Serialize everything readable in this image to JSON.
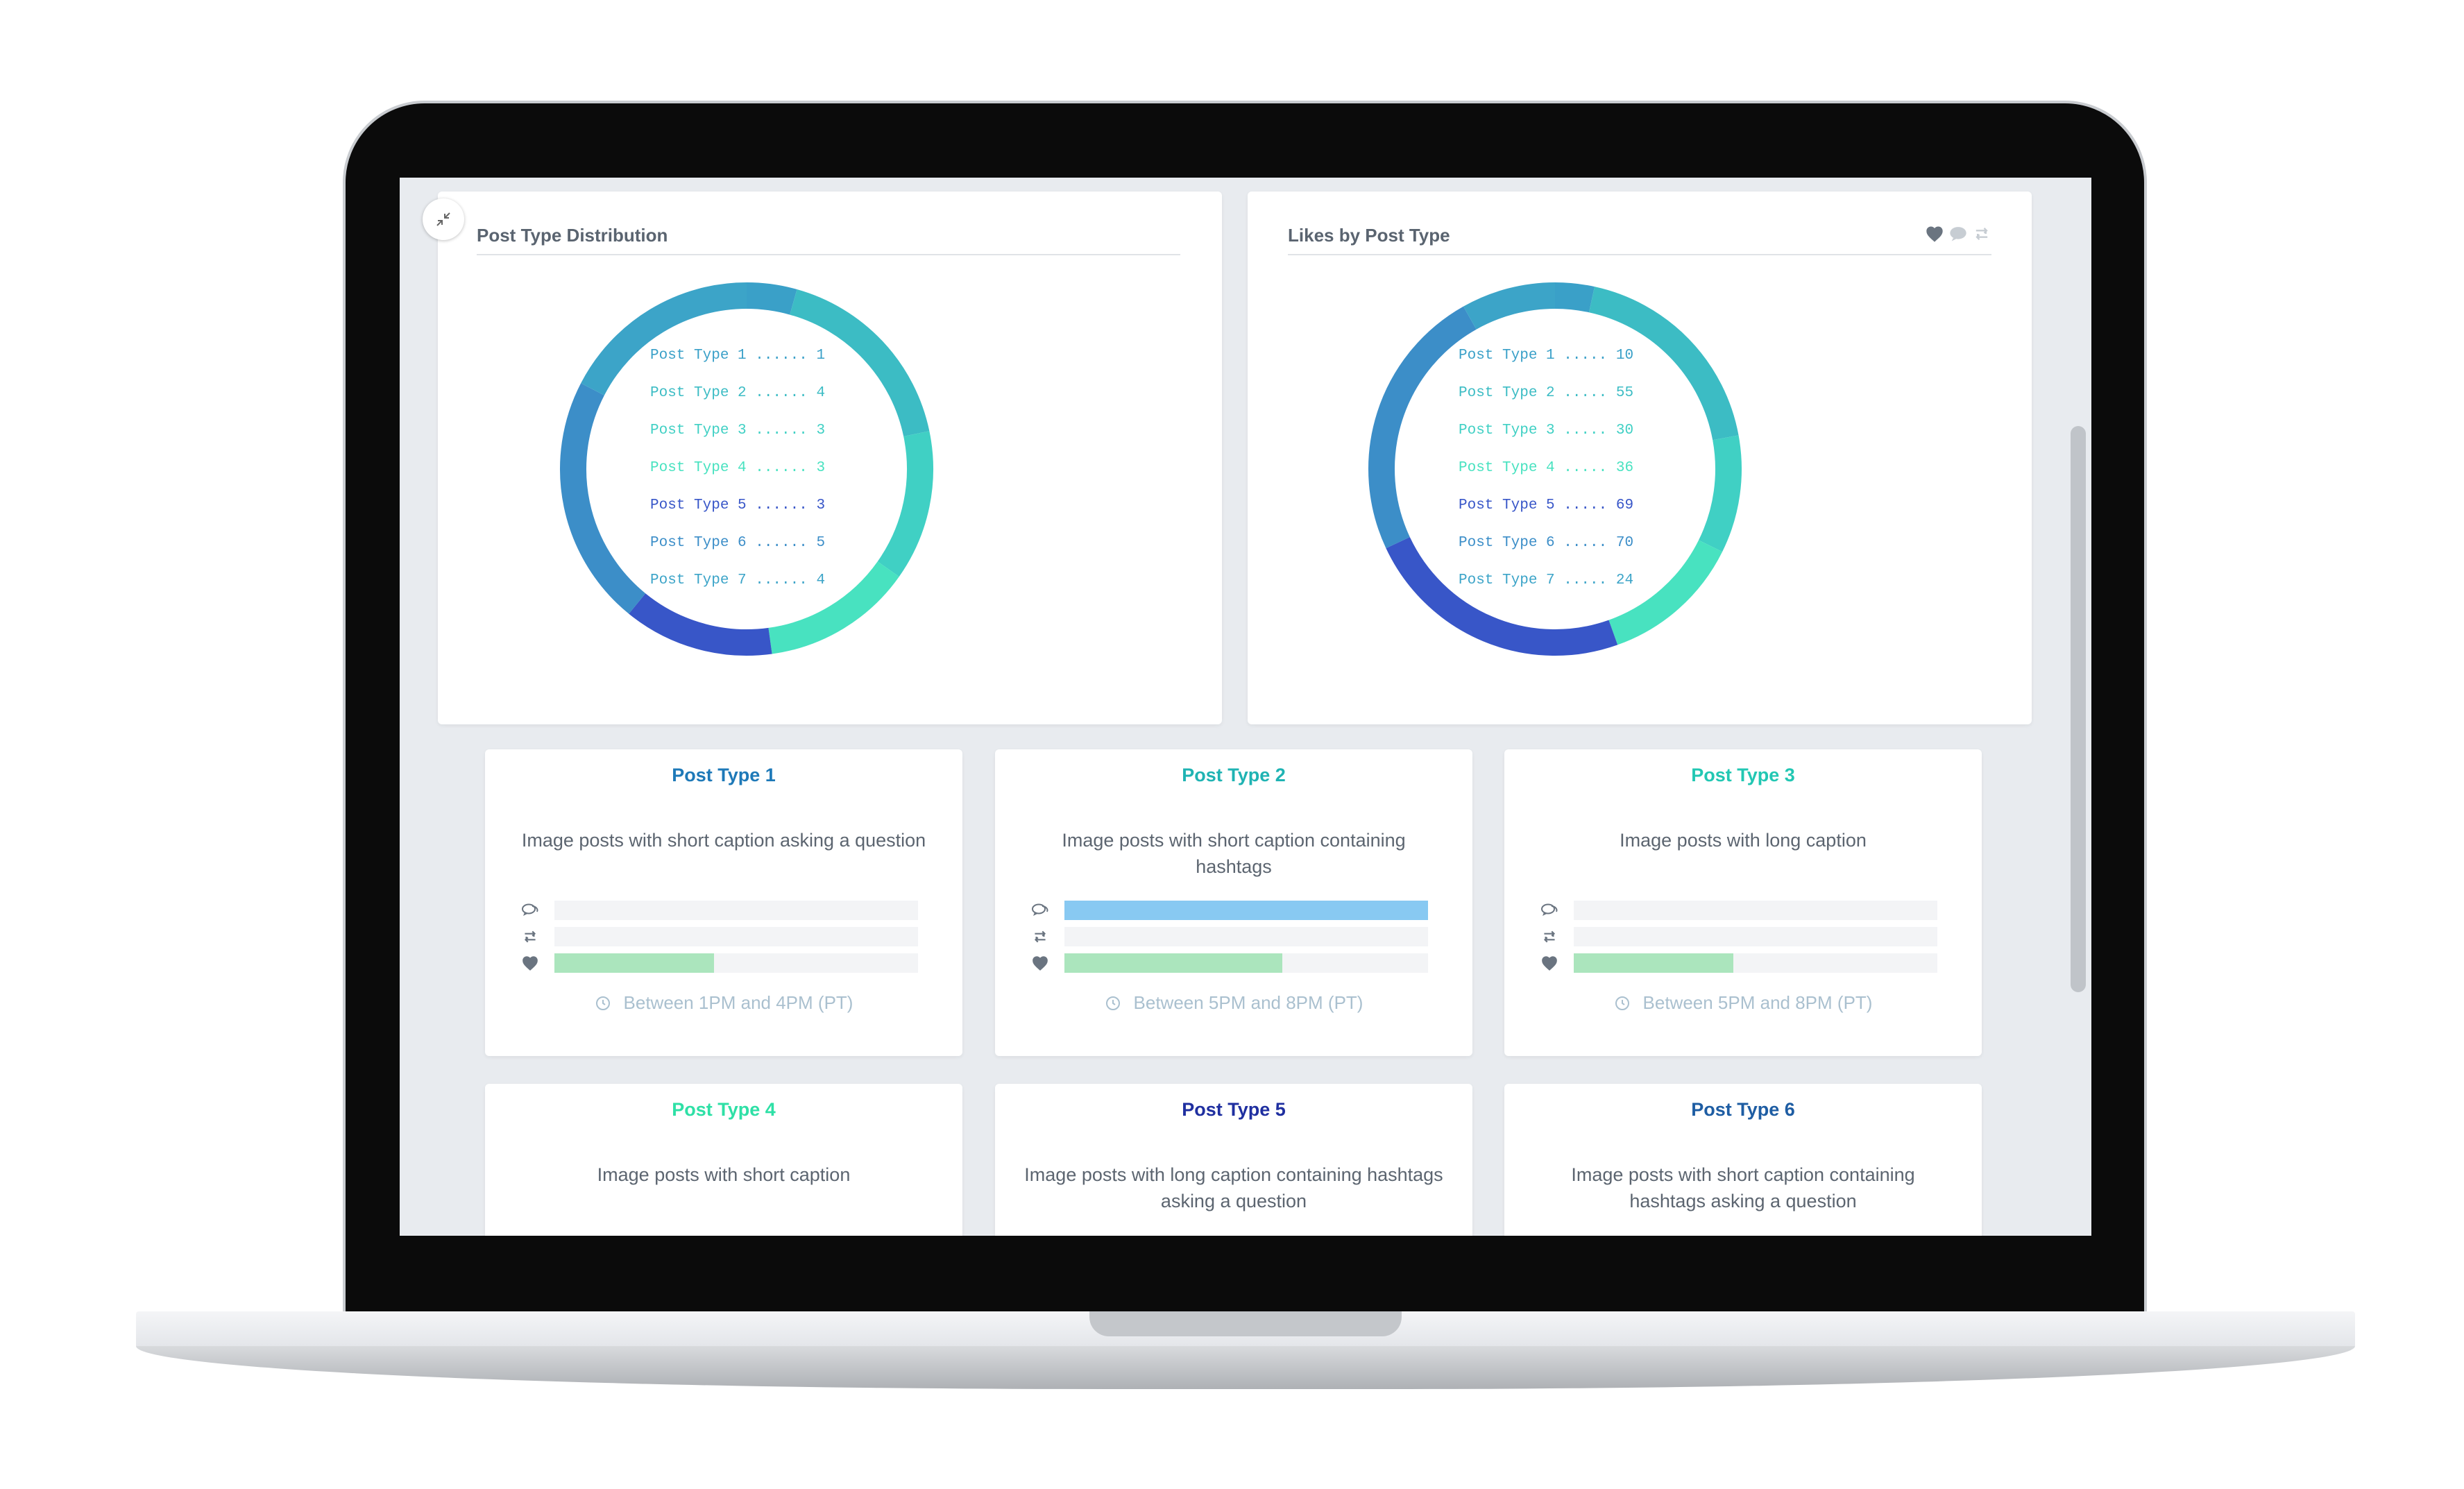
{
  "dashboard": {
    "distribution_panel": {
      "title": "Post Type Distribution",
      "legend": [
        {
          "text": "Post Type 1 ...... 1",
          "color": "#3aa0c8"
        },
        {
          "text": "Post Type 2 ...... 4",
          "color": "#3cbcc4"
        },
        {
          "text": "Post Type 3 ...... 3",
          "color": "#40d0c4"
        },
        {
          "text": "Post Type 4 ...... 3",
          "color": "#48e2c0"
        },
        {
          "text": "Post Type 5 ...... 3",
          "color": "#3856c8"
        },
        {
          "text": "Post Type 6 ...... 5",
          "color": "#3c8ec8"
        },
        {
          "text": "Post Type 7 ...... 4",
          "color": "#3ca4c8"
        }
      ]
    },
    "likes_panel": {
      "title": "Likes by Post Type",
      "icons": [
        "heart-icon",
        "comment-icon",
        "retweet-icon"
      ],
      "legend": [
        {
          "text": "Post Type 1 ..... 10",
          "color": "#3aa0c8"
        },
        {
          "text": "Post Type 2 ..... 55",
          "color": "#3cbcc4"
        },
        {
          "text": "Post Type 3 ..... 30",
          "color": "#40d0c4"
        },
        {
          "text": "Post Type 4 ..... 36",
          "color": "#48e2c0"
        },
        {
          "text": "Post Type 5 ..... 69",
          "color": "#3856c8"
        },
        {
          "text": "Post Type 6 ..... 70",
          "color": "#3c8ec8"
        },
        {
          "text": "Post Type 7 ..... 24",
          "color": "#3ca4c8"
        }
      ]
    },
    "cards": [
      {
        "title": "Post Type 1",
        "title_color": "#1e79b8",
        "description": "Image posts with short caption asking a question",
        "comments": 0,
        "retweets": 0,
        "likes": 0.44,
        "time": "Between 1PM and 4PM (PT)"
      },
      {
        "title": "Post Type 2",
        "title_color": "#1fb3b3",
        "description": "Image posts with short caption containing hashtags",
        "comments": 1.0,
        "retweets": 0,
        "likes": 0.6,
        "time": "Between 5PM and 8PM (PT)"
      },
      {
        "title": "Post Type 3",
        "title_color": "#22c7b3",
        "description": "Image posts with long caption",
        "comments": 0,
        "retweets": 0,
        "likes": 0.44,
        "time": "Between 5PM and 8PM (PT)"
      },
      {
        "title": "Post Type 4",
        "title_color": "#2ee0a6",
        "description": "Image posts with short caption"
      },
      {
        "title": "Post Type 5",
        "title_color": "#1f2fa0",
        "description": "Image posts with long caption containing hashtags asking a question"
      },
      {
        "title": "Post Type 6",
        "title_color": "#1e5da3",
        "description": "Image posts with short caption containing hashtags asking a question"
      }
    ],
    "colors": {
      "comment_bar": "#88c9f2",
      "like_bar": "#abe5bd"
    }
  }
}
